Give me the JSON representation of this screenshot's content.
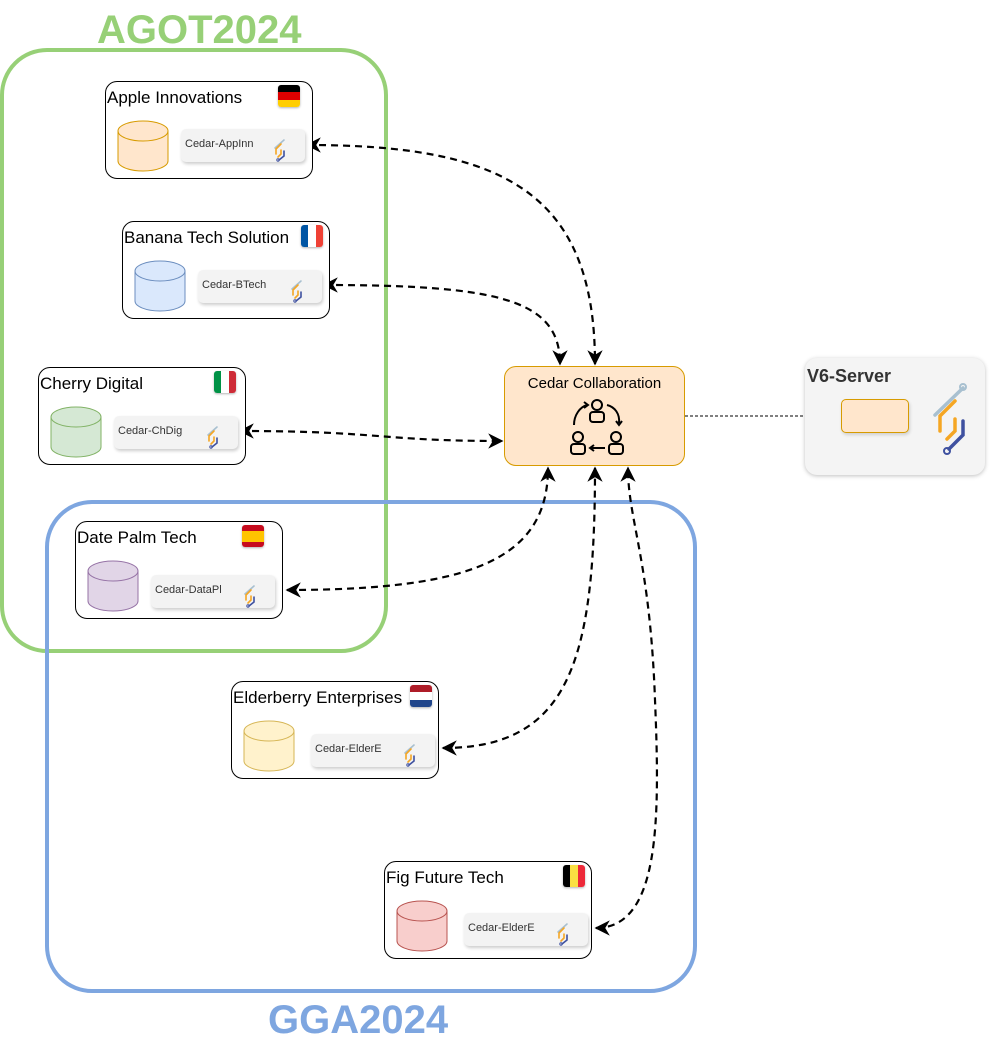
{
  "groups": {
    "agot": {
      "label": "AGOT2024",
      "color": "#97d077"
    },
    "gga": {
      "label": "GGA2024",
      "color": "#7ea6e0"
    }
  },
  "nodes": [
    {
      "title": "Apple Innovations",
      "station": "Cedar-AppInn",
      "flag": "germany",
      "db_fill": "#ffe6cc",
      "db_stroke": "#d79b00"
    },
    {
      "title": "Banana Tech Solution",
      "station": "Cedar-BTech",
      "flag": "france",
      "db_fill": "#dae8fc",
      "db_stroke": "#6c8ebf"
    },
    {
      "title": "Cherry Digital",
      "station": "Cedar-ChDig",
      "flag": "italy",
      "db_fill": "#d5e8d4",
      "db_stroke": "#82b366"
    },
    {
      "title": "Date Palm Tech",
      "station": "Cedar-DataPl",
      "flag": "spain",
      "db_fill": "#e1d5e7",
      "db_stroke": "#9673a6"
    },
    {
      "title": "Elderberry Enterprises",
      "station": "Cedar-ElderE",
      "flag": "netherlands",
      "db_fill": "#fff2cc",
      "db_stroke": "#d6b656"
    },
    {
      "title": "Fig Future Tech",
      "station": "Cedar-ElderE",
      "flag": "belgium",
      "db_fill": "#f8cecc",
      "db_stroke": "#b85450"
    }
  ],
  "hub": {
    "title": "Cedar Collaboration",
    "icon": "collaboration-cycle-icon"
  },
  "server": {
    "title": "V6-Server",
    "icon": "vantage6-logo-icon"
  }
}
